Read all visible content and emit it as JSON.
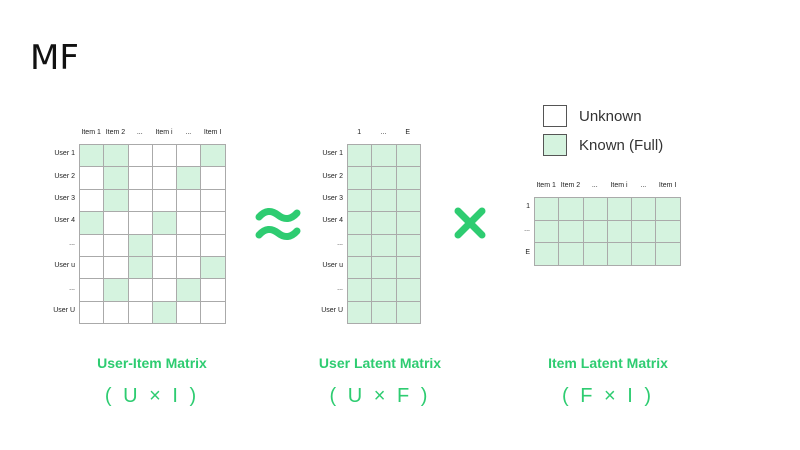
{
  "title": "MF",
  "legend": {
    "unknown": "Unknown",
    "known": "Known (Full)"
  },
  "colors": {
    "known": "#d5f3df",
    "accent": "#2ecc71",
    "grid": "#aaaaaa"
  },
  "user_item": {
    "cols": [
      "Item 1",
      "Item 2",
      "...",
      "Item i",
      "...",
      "Item I"
    ],
    "rows": [
      "User 1",
      "User 2",
      "User 3",
      "User 4",
      "...",
      "User u",
      "...",
      "User U"
    ],
    "known": [
      [
        1,
        1,
        0,
        0,
        0,
        1
      ],
      [
        0,
        1,
        0,
        0,
        1,
        0
      ],
      [
        0,
        1,
        0,
        0,
        0,
        0
      ],
      [
        1,
        0,
        0,
        1,
        0,
        0
      ],
      [
        0,
        0,
        1,
        0,
        0,
        0
      ],
      [
        0,
        0,
        1,
        0,
        0,
        1
      ],
      [
        0,
        1,
        0,
        0,
        1,
        0
      ],
      [
        0,
        0,
        0,
        1,
        0,
        0
      ]
    ],
    "caption": "User-Item Matrix",
    "dims": "( U × I )"
  },
  "user_latent": {
    "cols": [
      "1",
      "...",
      "E"
    ],
    "rows": [
      "User 1",
      "User 2",
      "User 3",
      "User 4",
      "...",
      "User u",
      "...",
      "User U"
    ],
    "caption": "User Latent Matrix",
    "dims": "( U × F )"
  },
  "item_latent": {
    "cols": [
      "Item 1",
      "Item 2",
      "...",
      "Item i",
      "...",
      "Item I"
    ],
    "rows": [
      "1",
      "...",
      "E"
    ],
    "caption": "Item Latent Matrix",
    "dims": "( F × I )"
  },
  "symbols": {
    "approx": "approx-icon",
    "times": "multiply-icon"
  }
}
